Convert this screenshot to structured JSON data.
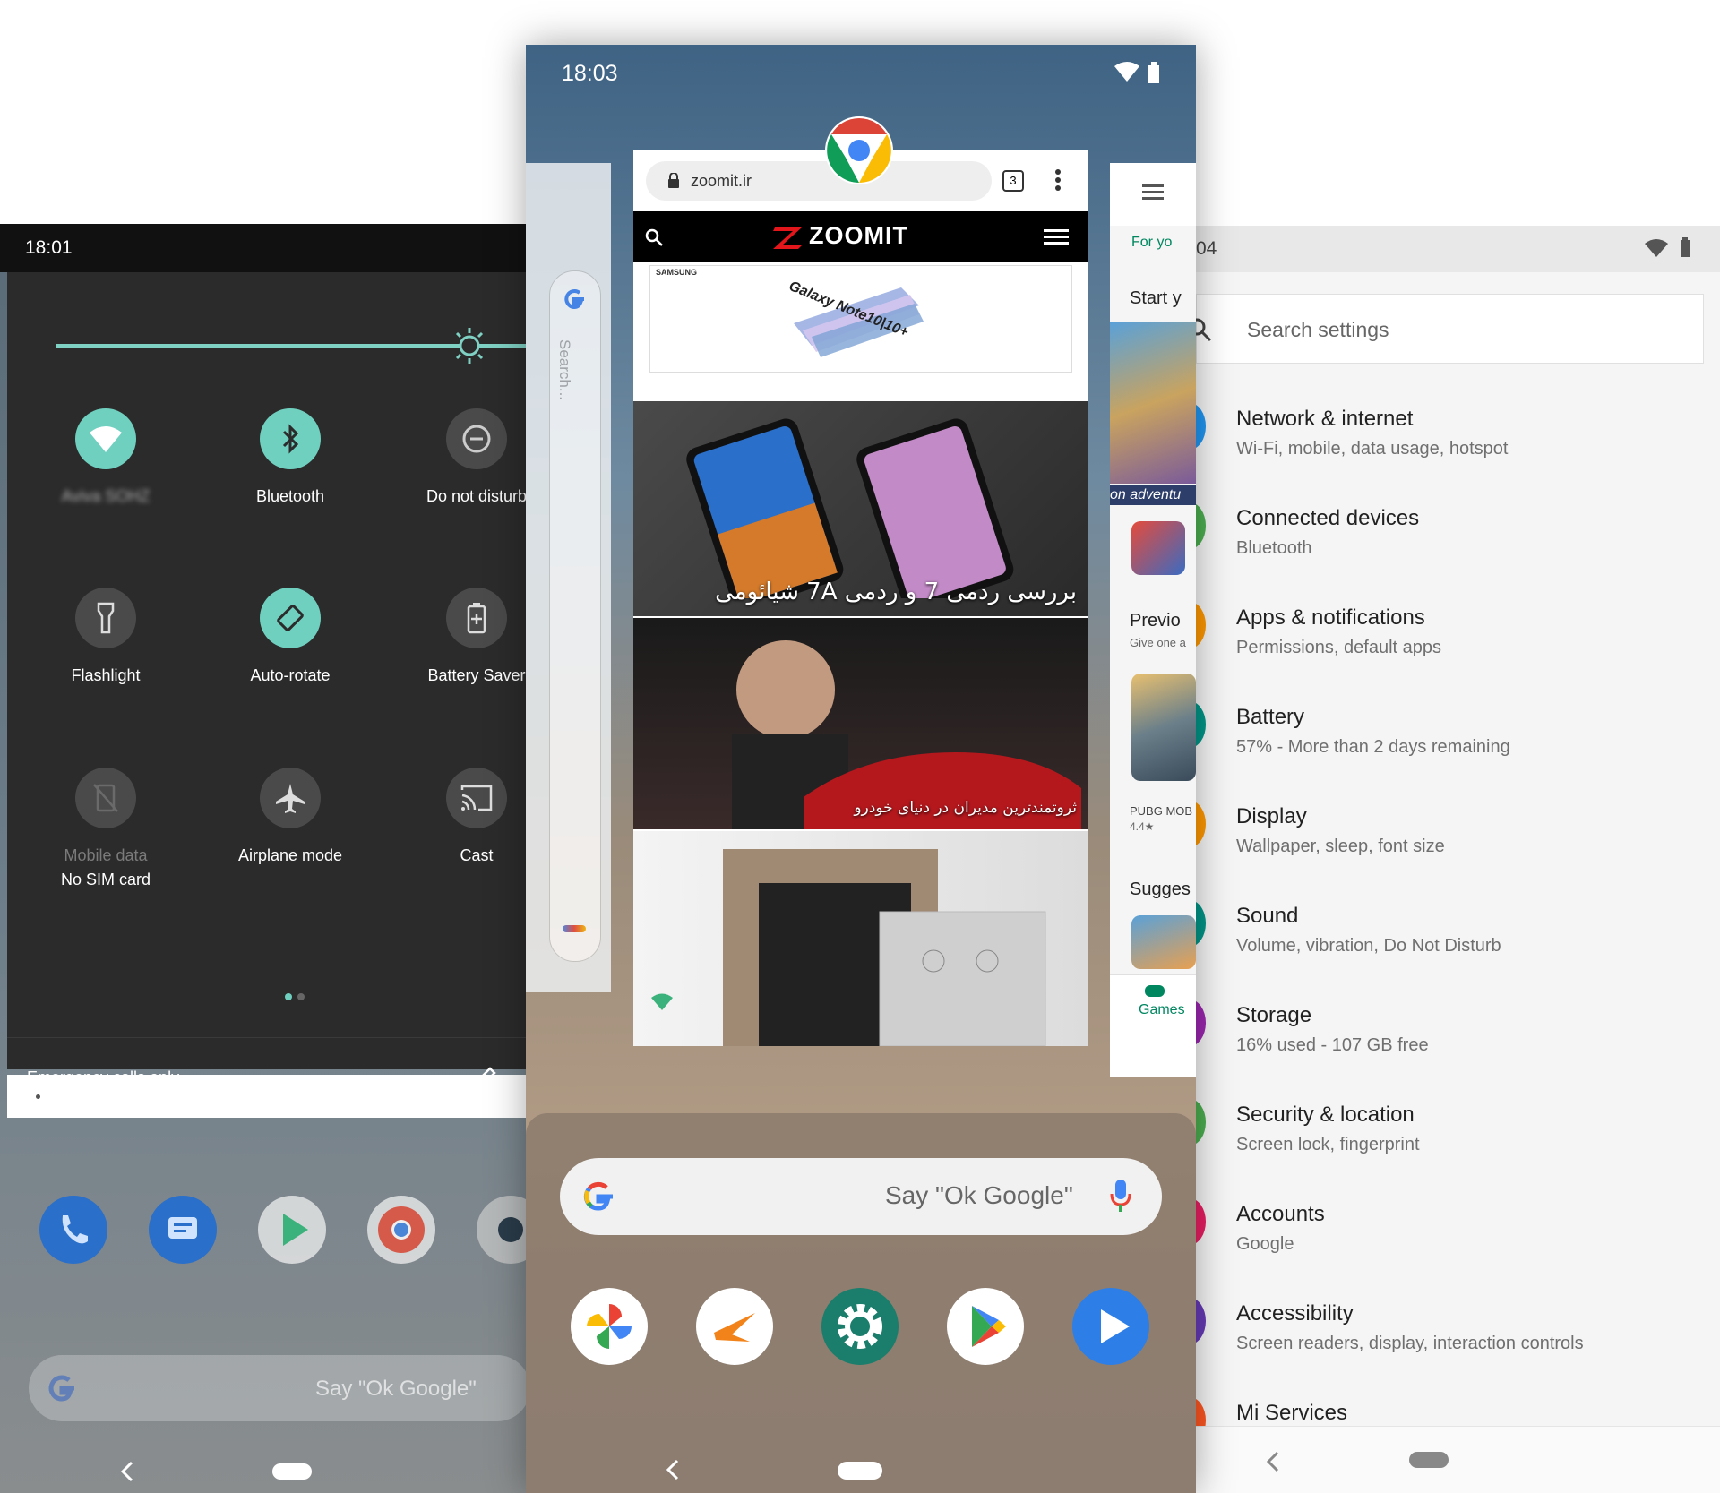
{
  "left_phone": {
    "time": "18:01",
    "tiles": [
      {
        "label": "Aviva SOHZ",
        "icon": "wifi-icon",
        "on": true
      },
      {
        "label": "Bluetooth",
        "icon": "bluetooth-icon",
        "on": true
      },
      {
        "label": "Do not disturb",
        "icon": "dnd-icon",
        "on": false
      },
      {
        "label": "Flashlight",
        "icon": "flashlight-icon",
        "on": false
      },
      {
        "label": "Auto-rotate",
        "icon": "auto-rotate-icon",
        "on": true
      },
      {
        "label": "Battery Saver",
        "icon": "battery-saver-icon",
        "on": false
      },
      {
        "label": "Mobile data",
        "sub": "No SIM card",
        "icon": "mobile-data-off-icon",
        "on": false
      },
      {
        "label": "Airplane mode",
        "icon": "airplane-icon",
        "on": false
      },
      {
        "label": "Cast",
        "icon": "cast-icon",
        "on": false
      }
    ],
    "emergency_text": "Emergency calls only",
    "search_hint": "Say \"Ok Google\""
  },
  "center_phone": {
    "time": "18:03",
    "url": "zoomit.ir",
    "tab_count": "3",
    "brand": "ZOOMIT",
    "ad_brand": "SAMSUNG",
    "ad_text": "Galaxy Note10|10+",
    "article_1": "بررسی ردمی 7 و ردمی 7A شیائومی",
    "article_2": "ثروتمندترین مدیران در دنیای خودرو",
    "side_search_hint": "Search...",
    "right_card": {
      "tab": "For yo",
      "start": "Start y",
      "adventure": "on adventu",
      "preview": "Previo",
      "give": "Give one a",
      "pubg": "PUBG MOB",
      "rating": "4.4★",
      "sugges": "Sugges",
      "games": "Games"
    },
    "search_hint": "Say \"Ok Google\""
  },
  "right_phone": {
    "time_partial": "04",
    "search_placeholder": "Search settings",
    "items": [
      {
        "title": "Network & internet",
        "subtitle": "Wi-Fi, mobile, data usage, hotspot",
        "color": "#2196f3"
      },
      {
        "title": "Connected devices",
        "subtitle": "Bluetooth",
        "color": "#4caf50"
      },
      {
        "title": "Apps & notifications",
        "subtitle": "Permissions, default apps",
        "color": "#ff9800"
      },
      {
        "title": "Battery",
        "subtitle": "57% - More than 2 days remaining",
        "color": "#009688"
      },
      {
        "title": "Display",
        "subtitle": "Wallpaper, sleep, font size",
        "color": "#ff9800"
      },
      {
        "title": "Sound",
        "subtitle": "Volume, vibration, Do Not Disturb",
        "color": "#009688"
      },
      {
        "title": "Storage",
        "subtitle": "16% used - 107 GB free",
        "color": "#9c27b0"
      },
      {
        "title": "Security & location",
        "subtitle": "Screen lock, fingerprint",
        "color": "#4caf50"
      },
      {
        "title": "Accounts",
        "subtitle": "Google",
        "color": "#e91e63"
      },
      {
        "title": "Accessibility",
        "subtitle": "Screen readers, display, interaction controls",
        "color": "#673ab7"
      },
      {
        "title": "Mi Services",
        "subtitle": "",
        "color": "#ff5722"
      }
    ]
  },
  "colors": {
    "accent_teal": "#6fd0c0",
    "qs_background": "#2b2b2b",
    "zoomit_red": "#e3161b"
  }
}
